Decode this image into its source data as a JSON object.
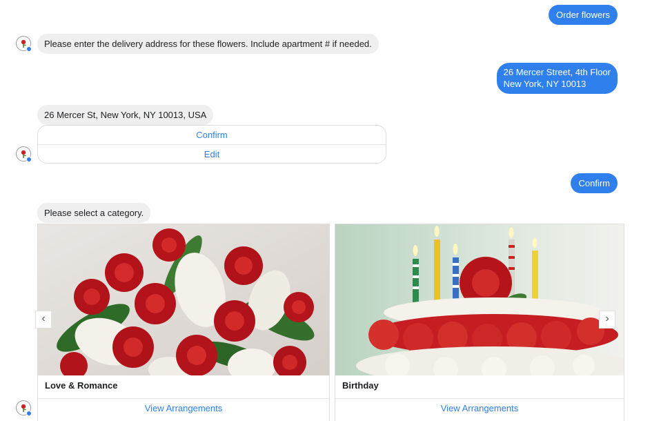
{
  "messages": {
    "order_flowers": "Order flowers",
    "address_prompt": "Please enter the delivery address for these flowers. Include apartment # if needed.",
    "address_line1": "26 Mercer Street, 4th Floor",
    "address_line2": "New York, NY 10013",
    "address_confirm_text": "26 Mercer St, New York, NY 10013, USA",
    "confirm_sent": "Confirm",
    "category_prompt": "Please select a category."
  },
  "quick_replies": {
    "confirm": "Confirm",
    "edit": "Edit"
  },
  "carousel": {
    "cards": [
      {
        "title": "Love & Romance",
        "action": "View Arrangements"
      },
      {
        "title": "Birthday",
        "action": "View Arrangements"
      }
    ],
    "prev_icon": "‹",
    "next_icon": "›"
  },
  "colors": {
    "accent": "#2f80ed",
    "incoming_bubble": "#efefef"
  },
  "icons": {
    "bot_avatar": "rose-logo-icon",
    "prev": "chevron-left-icon",
    "next": "chevron-right-icon"
  }
}
